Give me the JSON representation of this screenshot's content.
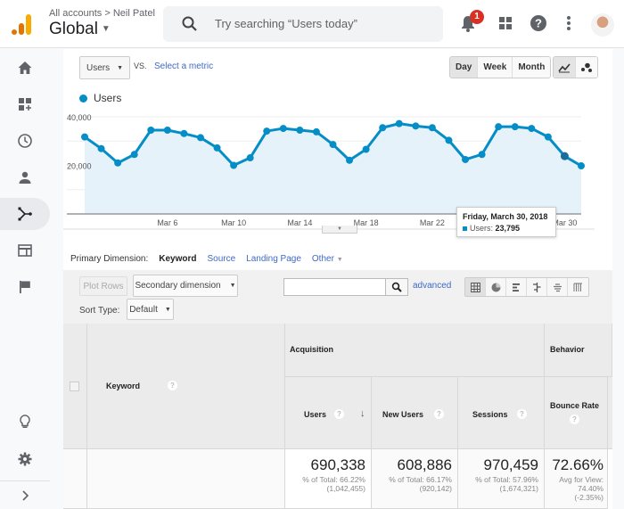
{
  "header": {
    "breadcrumb": "All accounts > Neil Patel",
    "account": "Global",
    "search_placeholder": "Try searching “Users today”",
    "notification_count": "1",
    "icons": [
      "analytics-logo-icon",
      "search-icon",
      "bell-icon",
      "apps-grid-icon",
      "help-icon",
      "more-vert-icon",
      "avatar"
    ]
  },
  "sidebar": {
    "items": [
      {
        "icon": "home-icon",
        "label": "Home"
      },
      {
        "icon": "customization-icon",
        "label": "Customization"
      },
      {
        "icon": "realtime-clock-icon",
        "label": "Realtime"
      },
      {
        "icon": "audience-person-icon",
        "label": "Audience"
      },
      {
        "icon": "acquisition-icon",
        "label": "Acquisition",
        "active": true
      },
      {
        "icon": "behavior-icon",
        "label": "Behavior"
      },
      {
        "icon": "conversions-flag-icon",
        "label": "Conversions"
      }
    ],
    "bottom": [
      {
        "icon": "discover-lightbulb-icon"
      },
      {
        "icon": "admin-gear-icon"
      },
      {
        "icon": "expand-chevron-icon"
      }
    ]
  },
  "controls": {
    "metric": "Users",
    "vs": "VS.",
    "select_metric": "Select a metric",
    "granularity": [
      "Day",
      "Week",
      "Month"
    ],
    "granularity_selected": "Day"
  },
  "chart_data": {
    "type": "area",
    "title": "",
    "legend": [
      "Users"
    ],
    "legend_position": "top-left",
    "color": "#058dc7",
    "x": [
      "Mar 1",
      "Mar 2",
      "Mar 3",
      "Mar 4",
      "Mar 5",
      "Mar 6",
      "Mar 7",
      "Mar 8",
      "Mar 9",
      "Mar 10",
      "Mar 11",
      "Mar 12",
      "Mar 13",
      "Mar 14",
      "Mar 15",
      "Mar 16",
      "Mar 17",
      "Mar 18",
      "Mar 19",
      "Mar 20",
      "Mar 21",
      "Mar 22",
      "Mar 23",
      "Mar 24",
      "Mar 25",
      "Mar 26",
      "Mar 27",
      "Mar 28",
      "Mar 29",
      "Mar 30",
      "Mar 31"
    ],
    "series": [
      {
        "name": "Users",
        "values": [
          31700,
          26900,
          21000,
          24500,
          34500,
          34500,
          33100,
          31400,
          27200,
          20000,
          23100,
          34100,
          35200,
          34500,
          33800,
          28600,
          22100,
          26600,
          35500,
          37200,
          36200,
          35500,
          30300,
          22400,
          24500,
          35900,
          35900,
          35200,
          31700,
          23795,
          19800
        ]
      }
    ],
    "xticks": [
      "Mar 6",
      "Mar 10",
      "Mar 14",
      "Mar 18",
      "Mar 22",
      "Mar 26",
      "Mar 30"
    ],
    "yticks": [
      "20,000",
      "40,000"
    ],
    "ylim": [
      0,
      40000
    ],
    "grid": true,
    "tooltip": {
      "date": "Friday, March 30, 2018",
      "label": "Users:",
      "value": "23,795"
    }
  },
  "dimensions": {
    "label": "Primary Dimension:",
    "current": "Keyword",
    "options": [
      "Source",
      "Landing Page",
      "Other"
    ]
  },
  "toolbar": {
    "plot_rows": "Plot Rows",
    "secondary_dimension": "Secondary dimension",
    "sort_type_label": "Sort Type:",
    "sort_type": "Default",
    "filter_value": "",
    "advanced": "advanced",
    "views": [
      "data-table-icon",
      "pie-chart-icon",
      "performance-bar-icon",
      "comparison-icon",
      "term-cloud-icon",
      "pivot-icon"
    ]
  },
  "table": {
    "keyword_header": "Keyword",
    "groups": [
      "Acquisition",
      "Behavior"
    ],
    "columns": [
      {
        "label": "Users",
        "value": "690,338",
        "sub1": "% of Total: 66.22%",
        "sub2": "(1,042,455)"
      },
      {
        "label": "New Users",
        "value": "608,886",
        "sub1": "% of Total: 66.17%",
        "sub2": "(920,142)"
      },
      {
        "label": "Sessions",
        "value": "970,459",
        "sub1": "% of Total: 57.96%",
        "sub2": "(1,674,321)"
      },
      {
        "label": "Bounce Rate",
        "value": "72.66%",
        "sub1": "Avg for View:",
        "sub2": "74.40%",
        "sub3": "(-2.35%)"
      }
    ]
  }
}
